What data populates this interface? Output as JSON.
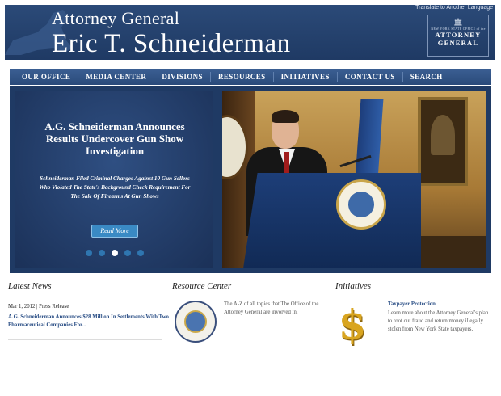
{
  "header": {
    "title_line1": "Attorney General",
    "title_line2": "Eric T. Schneiderman",
    "translate_link": "Translate to Another Language",
    "seal": {
      "icon": "building-icon",
      "small_text": "NEW YORK STATE OFFICE of the",
      "title": "ATTORNEY GENERAL"
    },
    "colors": {
      "banner": "#1f3a64",
      "text": "#ffffff"
    }
  },
  "nav": {
    "items": [
      {
        "label": "OUR OFFICE"
      },
      {
        "label": "MEDIA CENTER"
      },
      {
        "label": "DIVISIONS"
      },
      {
        "label": "RESOURCES"
      },
      {
        "label": "INITIATIVES"
      },
      {
        "label": "CONTACT US"
      },
      {
        "label": "SEARCH"
      }
    ]
  },
  "hero": {
    "headline": "A.G. Schneiderman Announces Results Undercover Gun Show Investigation",
    "summary": "Schneiderman Filed Criminal Charges Against 10 Gun Sellers Who Violated The State's Background Check Requirement For The Sale Of Firearms At Gun Shows",
    "read_more": "Read More",
    "slides": {
      "count": 5,
      "active_index": 2
    },
    "colors": {
      "button": "#3a8ac4",
      "dot": "#2f76b0",
      "dot_active": "#ffffff"
    }
  },
  "latest_news": {
    "title": "Latest News",
    "meta": "Mar 1, 2012 | Press Release",
    "link": "A.G. Schneiderman Announces $28 Million In Settlements With Two Pharmaceutical Companies For..."
  },
  "resource_center": {
    "title": "Resource Center",
    "description": "The A-Z of all topics that The Office of the Attorney General are involved in.",
    "icon": "state-seal-icon"
  },
  "initiatives": {
    "title": "Initiatives",
    "icon": "dollar-icon",
    "item_title": "Taxpayer Protection",
    "item_text": "Learn more about the Attorney General's plan to root out fraud and return money illegally stolen from New York State taxpayers."
  }
}
